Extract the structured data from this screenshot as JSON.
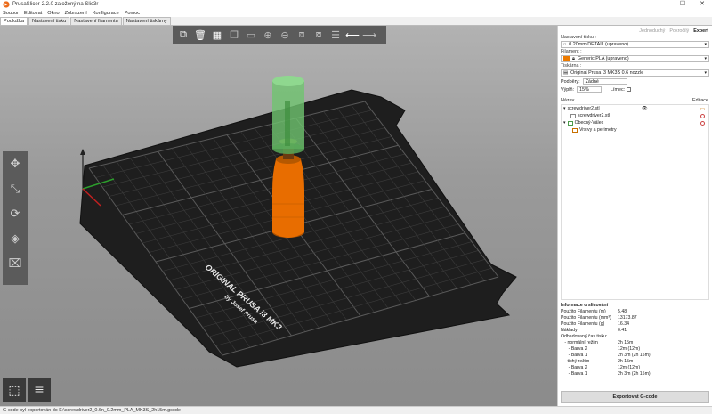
{
  "window": {
    "title": "PrusaSlicer-2.2.0 založený na Slic3r",
    "controls": [
      "—",
      "☐",
      "✕"
    ]
  },
  "menu": [
    "Soubor",
    "Editovat",
    "Okno",
    "Zobrazení",
    "Konfigurace",
    "Pomoc"
  ],
  "tabs": [
    {
      "label": "Podložka",
      "active": true
    },
    {
      "label": "Nastavení tisku",
      "active": false
    },
    {
      "label": "Nastavení filamentu",
      "active": false
    },
    {
      "label": "Nastavení tiskárny",
      "active": false
    }
  ],
  "toolbar": {
    "add_icon": "cube-icon",
    "delete_icon": "trash-icon",
    "arrange_icon": "arrange-icon",
    "undo_icon": "arrow-left-icon",
    "redo_icon": "arrow-right-icon"
  },
  "bed": {
    "label_line1": "ORIGINAL PRUSA i3 MK3",
    "label_line2": "by Josef Prusa"
  },
  "modes": {
    "simple": {
      "label": "Jednoduchý",
      "color": "#47b547"
    },
    "advanced": {
      "label": "Pokročilý",
      "color": "#e8c61a"
    },
    "expert": {
      "label": "Expert",
      "color": "#d12a2a"
    }
  },
  "print_settings": {
    "label": "Nastavení tisku :",
    "value": "0.20mm DETAIL (upraveno)"
  },
  "filament": {
    "label": "Filament :",
    "value": "Generic PLA (upraveno)",
    "color": "#ec7a00"
  },
  "printer": {
    "label": "Tiskárna :",
    "value": "Original Prusa i3 MK3S 0.6 nozzle"
  },
  "supports": {
    "label": "Podpěry:",
    "value": "Žádné"
  },
  "infill": {
    "label": "Výplň:",
    "value": "15%"
  },
  "brim": {
    "label": "Límec:"
  },
  "objects": {
    "col_name": "Název",
    "col_edit": "Editace",
    "items": [
      {
        "name": "screwdriver2.stl",
        "level": 0
      },
      {
        "name": "screwdriver2.stl",
        "level": 1
      },
      {
        "name": "Obecný-Válec",
        "level": 1
      },
      {
        "name": "Vrstvy a perimetry",
        "level": 2
      }
    ]
  },
  "slice_info": {
    "title": "Informace o slicování",
    "rows": [
      {
        "k": "Použito Filamentu (m)",
        "v": "5.48"
      },
      {
        "k": "Použito Filamentu (mm³)",
        "v": "13173.87"
      },
      {
        "k": "Použito Filamentu (g)",
        "v": "16.34"
      },
      {
        "k": "Náklady",
        "v": "0.41"
      },
      {
        "k": "Odhadovaný čas tisku:",
        "v": ""
      },
      {
        "k": "   - normální režim",
        "v": "2h 15m"
      },
      {
        "k": "      - Barva 2",
        "v": "12m (12m)"
      },
      {
        "k": "      - Barva 1",
        "v": "2h 3m (2h 15m)"
      },
      {
        "k": "   - tichý režim",
        "v": "2h 15m"
      },
      {
        "k": "      - Barva 2",
        "v": "12m (12m)"
      },
      {
        "k": "      - Barva 1",
        "v": "2h 3m (2h 15m)"
      }
    ]
  },
  "export_label": "Exportovat G-code",
  "status": "G-code byl exportován do E:\\screwdriver2_0.6n_0.2mm_PLA_MK3S_2h15m.gcode"
}
